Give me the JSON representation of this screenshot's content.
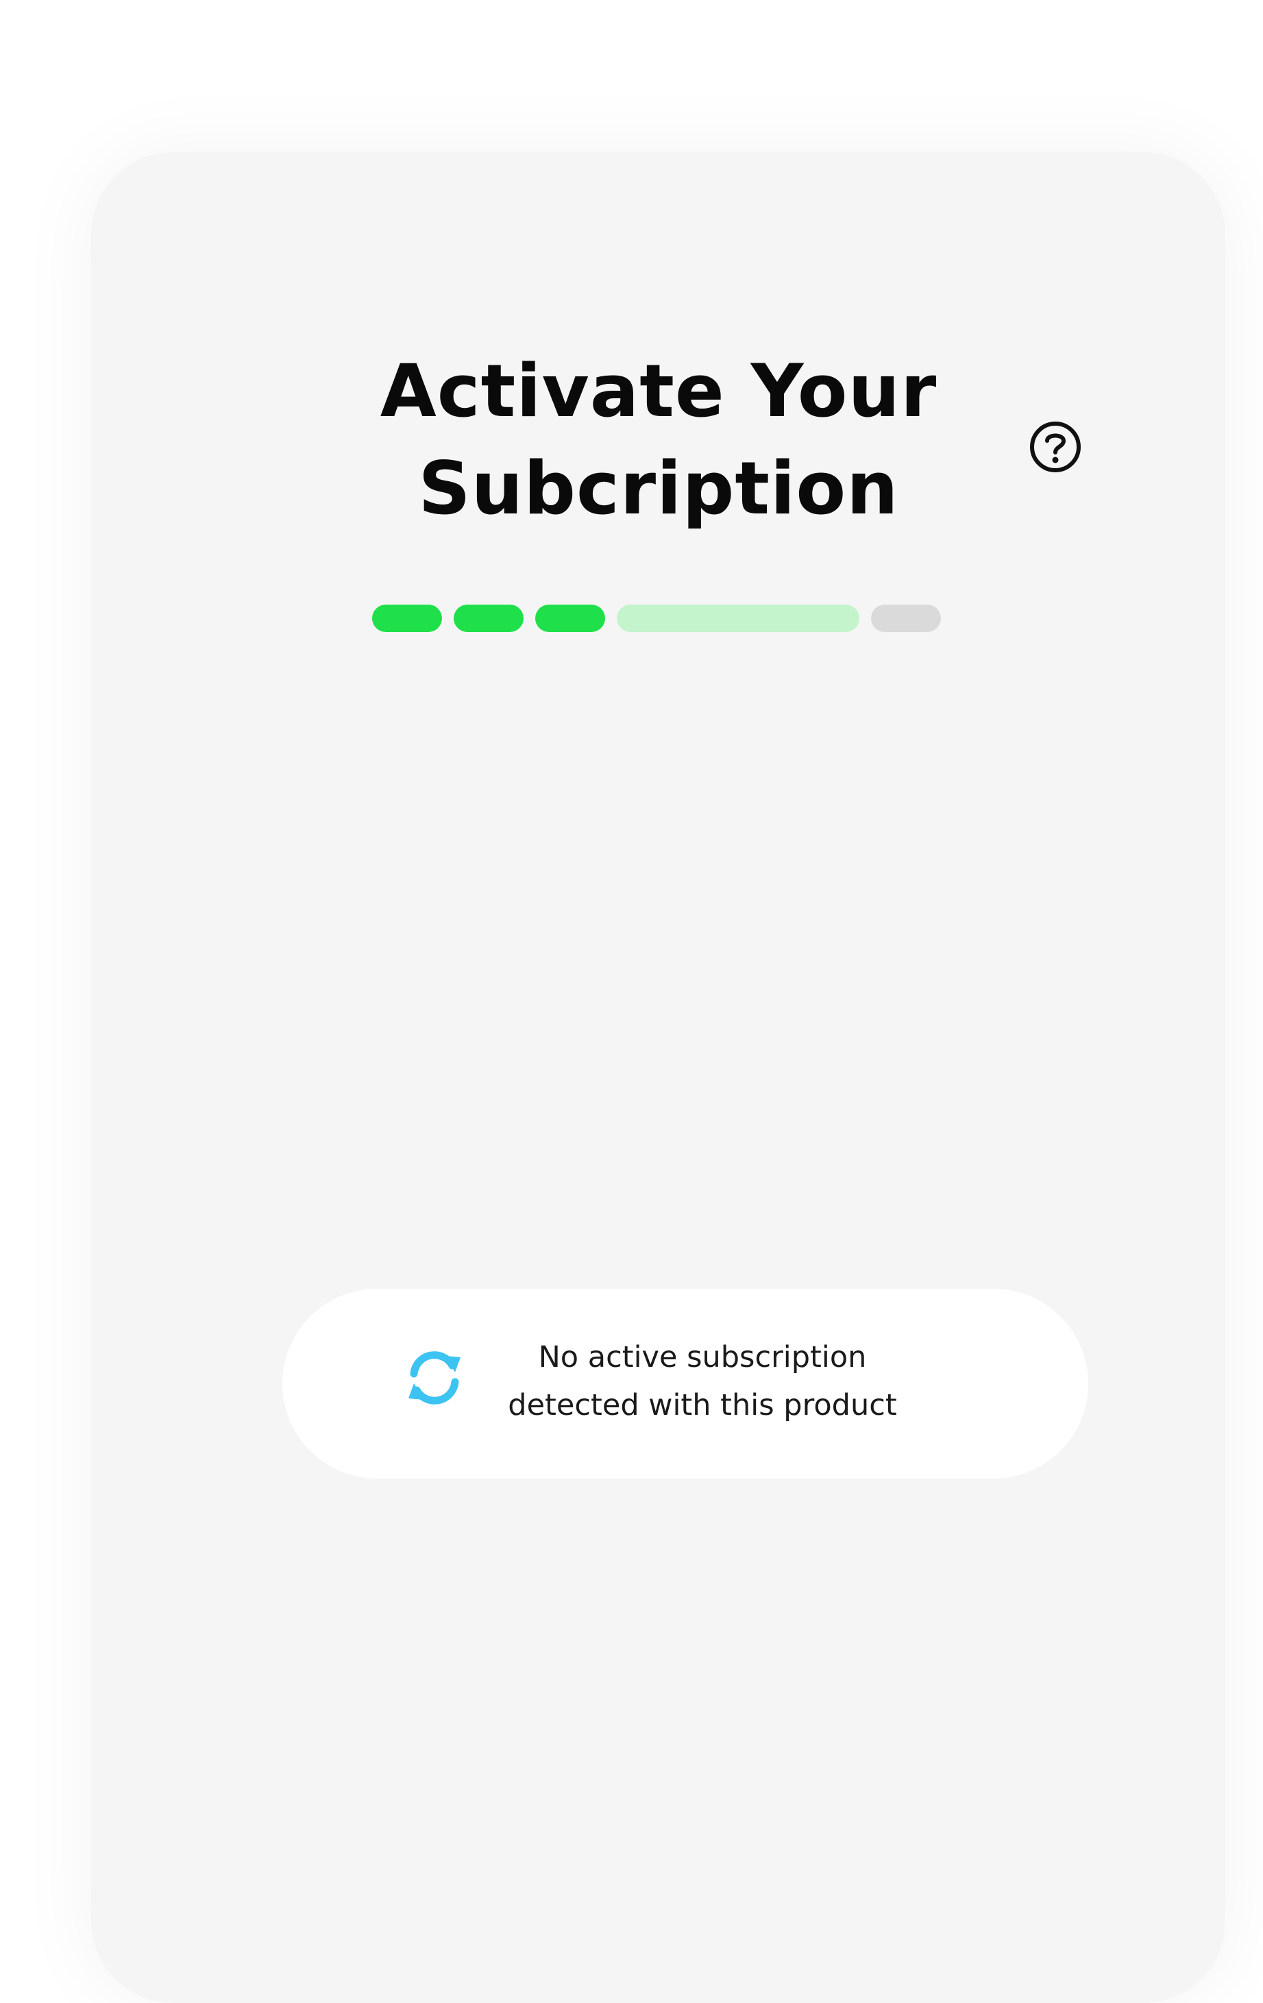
{
  "screen": {
    "title": "Activate Your Subcription",
    "help_icon": "question-circle-icon"
  },
  "progress": {
    "completed_steps": 3,
    "current_step": 4,
    "total_steps": 5,
    "colors": {
      "completed": "#1fe04a",
      "current": "#c3f4cb",
      "pending": "#dadada"
    }
  },
  "status": {
    "icon": "sync-icon",
    "icon_color": "#3cc3f2",
    "message": "No active subscription detected with this product"
  }
}
